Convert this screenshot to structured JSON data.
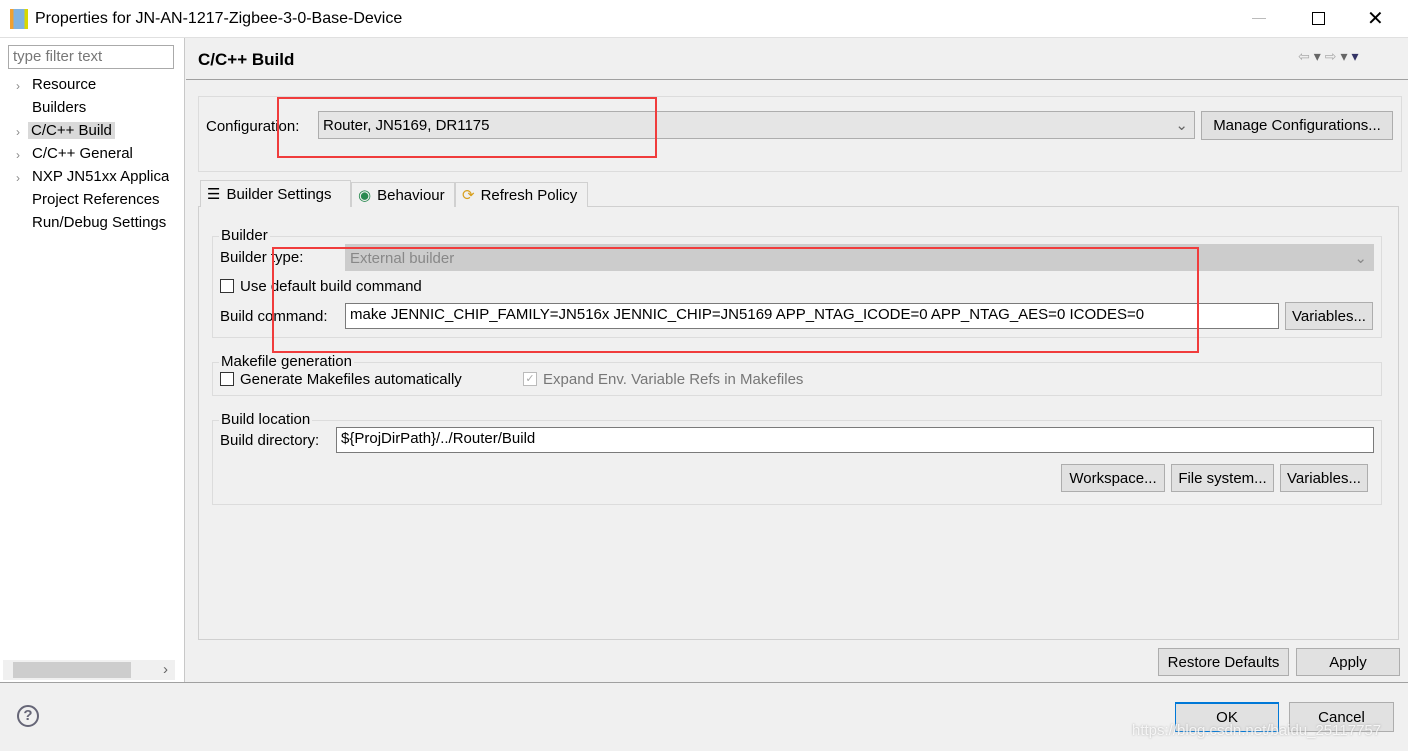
{
  "window": {
    "title": "Properties for JN-AN-1217-Zigbee-3-0-Base-Device"
  },
  "sidebar": {
    "filter_placeholder": "type filter text",
    "items": [
      {
        "label": "Resource",
        "expandable": true
      },
      {
        "label": "Builders",
        "expandable": false
      },
      {
        "label": "C/C++ Build",
        "expandable": true,
        "selected": true
      },
      {
        "label": "C/C++ General",
        "expandable": true
      },
      {
        "label": "NXP JN51xx Applica",
        "expandable": true
      },
      {
        "label": "Project References",
        "expandable": false
      },
      {
        "label": "Run/Debug Settings",
        "expandable": false
      }
    ]
  },
  "page": {
    "title": "C/C++ Build",
    "configuration": {
      "label": "Configuration:",
      "value": "Router, JN5169, DR1175",
      "manage_label": "Manage Configurations..."
    },
    "tabs": [
      {
        "label": "Builder Settings",
        "icon": "list-icon",
        "active": true
      },
      {
        "label": "Behaviour",
        "icon": "radio-icon"
      },
      {
        "label": "Refresh Policy",
        "icon": "refresh-icon"
      }
    ],
    "builder": {
      "group": "Builder",
      "type_label": "Builder type:",
      "type_value": "External builder",
      "use_default_label": "Use default build command",
      "use_default_checked": false,
      "command_label": "Build command:",
      "command_value": "make JENNIC_CHIP_FAMILY=JN516x JENNIC_CHIP=JN5169 APP_NTAG_ICODE=0 APP_NTAG_AES=0 ICODES=0",
      "variables_label": "Variables..."
    },
    "makefile": {
      "group": "Makefile generation",
      "generate_label": "Generate Makefiles automatically",
      "generate_checked": false,
      "expand_label": "Expand Env. Variable Refs in Makefiles",
      "expand_checked": true
    },
    "location": {
      "group": "Build location",
      "dir_label": "Build directory:",
      "dir_value": "${ProjDirPath}/../Router/Build",
      "workspace_label": "Workspace...",
      "filesystem_label": "File system...",
      "variables_label": "Variables..."
    },
    "restore_label": "Restore Defaults",
    "apply_label": "Apply"
  },
  "footer": {
    "ok_label": "OK",
    "cancel_label": "Cancel"
  },
  "watermark": "https://blog.csdn.net/baidu_25117757",
  "colors": {
    "highlight": "#f03c3c",
    "selection": "#d9d9d9",
    "ok_border": "#0078d7"
  }
}
